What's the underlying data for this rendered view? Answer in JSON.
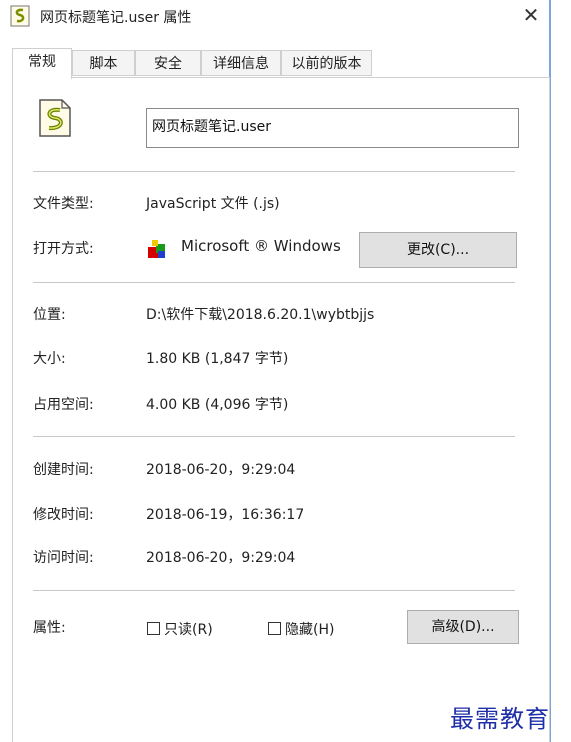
{
  "window": {
    "title": "网页标题笔记.user 属性",
    "close_glyph": "✕",
    "icon": "script-file-icon"
  },
  "tabs": [
    {
      "label": "常规",
      "active": true
    },
    {
      "label": "脚本",
      "active": false
    },
    {
      "label": "安全",
      "active": false
    },
    {
      "label": "详细信息",
      "active": false
    },
    {
      "label": "以前的版本",
      "active": false
    }
  ],
  "general": {
    "file_name": "网页标题笔记.user",
    "file_type_label": "文件类型:",
    "file_type_value": "JavaScript 文件 (.js)",
    "opens_with_label": "打开方式:",
    "opens_with_value": "Microsoft ® Windows",
    "change_button": "更改(C)...",
    "location_label": "位置:",
    "location_value": "D:\\软件下载\\2018.6.20.1\\wybtbjjs",
    "size_label": "大小:",
    "size_value": "1.80 KB (1,847 字节)",
    "size_on_disk_label": "占用空间:",
    "size_on_disk_value": "4.00 KB (4,096 字节)",
    "created_label": "创建时间:",
    "created_value": "2018-06-20，9:29:04",
    "modified_label": "修改时间:",
    "modified_value": "2018-06-19，16:36:17",
    "accessed_label": "访问时间:",
    "accessed_value": "2018-06-20，9:29:04",
    "attributes_label": "属性:",
    "readonly_label": "只读(R)",
    "readonly_checked": false,
    "hidden_label": "隐藏(H)",
    "hidden_checked": false,
    "advanced_button": "高级(D)..."
  },
  "watermark": "最需教育",
  "colors": {
    "accent_edge": "#7aa7d8",
    "watermark": "#1f2fa8"
  }
}
